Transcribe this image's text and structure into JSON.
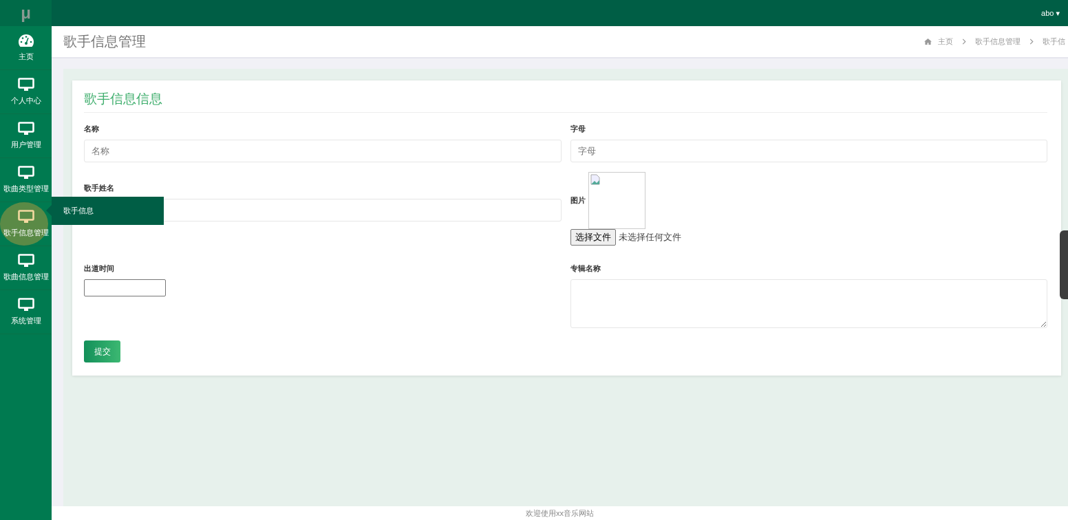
{
  "logo": "μ",
  "user": {
    "name": "abo",
    "caret": "▾"
  },
  "sidebar": {
    "items": [
      {
        "label": "主页",
        "selected": false
      },
      {
        "label": "个人中心",
        "selected": false
      },
      {
        "label": "用户管理",
        "selected": false
      },
      {
        "label": "歌曲类型管理",
        "selected": false
      },
      {
        "label": "歌手信息管理",
        "selected": true
      },
      {
        "label": "歌曲信息管理",
        "selected": false
      },
      {
        "label": "系统管理",
        "selected": false
      }
    ]
  },
  "flyout": {
    "items": [
      "歌手信息"
    ]
  },
  "page_title": "歌手信息管理",
  "breadcrumb": [
    "主页",
    "歌手信息管理",
    "歌手信"
  ],
  "card": {
    "title": "歌手信息信息",
    "fields": [
      {
        "kind": "text",
        "label": "名称",
        "placeholder": "名称"
      },
      {
        "kind": "text",
        "label": "字母",
        "placeholder": "字母"
      },
      {
        "kind": "text",
        "label": "歌手姓名"
      },
      {
        "kind": "image",
        "label": "图片",
        "button": "选择文件",
        "status": "未选择任何文件"
      },
      {
        "kind": "date",
        "label": "出道时间"
      },
      {
        "kind": "textarea",
        "label": "专辑名称"
      }
    ],
    "submit": "提交"
  },
  "footer": "欢迎使用xx音乐网站"
}
